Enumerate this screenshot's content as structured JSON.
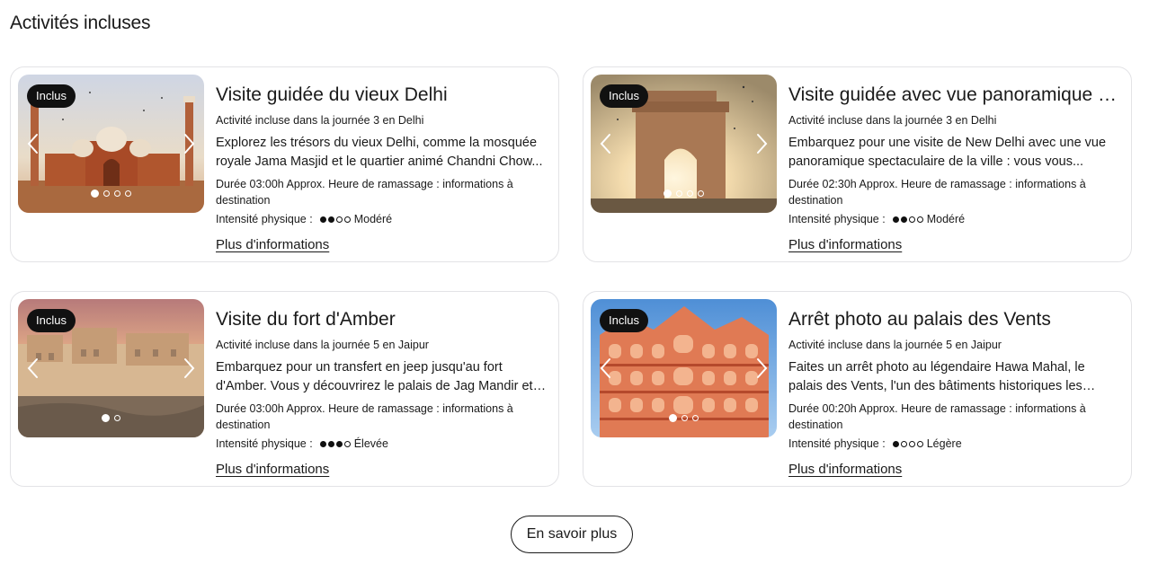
{
  "section": {
    "title": "Activités incluses"
  },
  "labels": {
    "badge": "Inclus",
    "intensity_label": "Intensité physique :",
    "more_link": "Plus d'informations"
  },
  "activities": [
    {
      "title": "Visite guidée du vieux Delhi",
      "subtitle": "Activité incluse dans la journée 3 en Delhi",
      "description": "Explorez les trésors du vieux Delhi, comme la mosquée royale Jama Masjid et le quartier animé Chandni Chow...",
      "duration": "Durée 03:00h Approx. Heure de ramassage : informations à destination",
      "intensity_level": 2,
      "intensity_text": "Modéré",
      "image_icon": "jama-masjid-photo",
      "slide_count": 4,
      "active_slide": 1
    },
    {
      "title": "Visite guidée avec vue panoramique s...",
      "subtitle": "Activité incluse dans la journée 3 en Delhi",
      "description": "Embarquez pour une visite de New Delhi avec une vue panoramique spectaculaire de la ville : vous vous...",
      "duration": "Durée 02:30h Approx. Heure de ramassage : informations à destination",
      "intensity_level": 2,
      "intensity_text": "Modéré",
      "image_icon": "india-gate-photo",
      "slide_count": 4,
      "active_slide": 1
    },
    {
      "title": "Visite du fort d'Amber",
      "subtitle": "Activité incluse dans la journée 5 en Jaipur",
      "description": "Embarquez pour un transfert en jeep jusqu'au fort d'Amber. Vous y découvrirez le palais de Jag Mandir et l...",
      "duration": "Durée 03:00h Approx. Heure de ramassage : informations à destination",
      "intensity_level": 3,
      "intensity_text": "Élevée",
      "image_icon": "amber-fort-photo",
      "slide_count": 2,
      "active_slide": 1
    },
    {
      "title": "Arrêt photo au palais des Vents",
      "subtitle": "Activité incluse dans la journée 5 en Jaipur",
      "description": "Faites un arrêt photo au légendaire Hawa Mahal, le palais des Vents, l'un des bâtiments historiques les plus...",
      "duration": "Durée 00:20h Approx. Heure de ramassage : informations à destination",
      "intensity_level": 1,
      "intensity_text": "Légère",
      "image_icon": "hawa-mahal-photo",
      "slide_count": 3,
      "active_slide": 1
    }
  ],
  "cta": {
    "label": "En savoir plus"
  }
}
